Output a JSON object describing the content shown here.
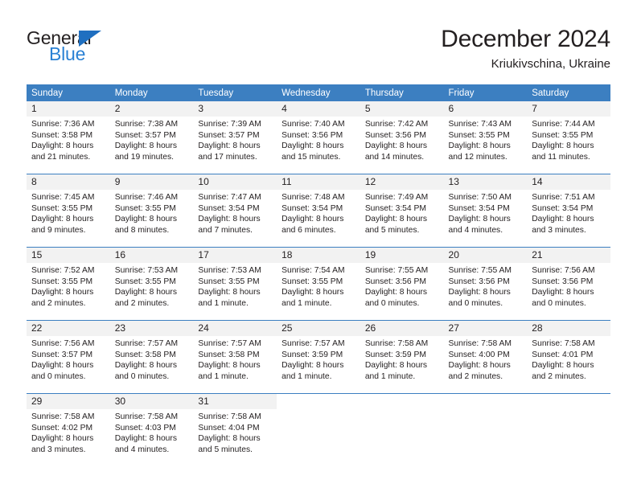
{
  "brand": {
    "name_top": "General",
    "name_bottom": "Blue",
    "color_dark": "#231f20",
    "color_blue": "#2a81d4"
  },
  "header": {
    "title": "December 2024",
    "subtitle": "Kriukivschina, Ukraine"
  },
  "theme": {
    "header_bg": "#3c7fc1",
    "daynum_bg": "#f2f2f2",
    "text": "#231f20"
  },
  "weekdays": [
    "Sunday",
    "Monday",
    "Tuesday",
    "Wednesday",
    "Thursday",
    "Friday",
    "Saturday"
  ],
  "weeks": [
    [
      {
        "day": "1",
        "sunrise": "Sunrise: 7:36 AM",
        "sunset": "Sunset: 3:58 PM",
        "daylight1": "Daylight: 8 hours",
        "daylight2": "and 21 minutes."
      },
      {
        "day": "2",
        "sunrise": "Sunrise: 7:38 AM",
        "sunset": "Sunset: 3:57 PM",
        "daylight1": "Daylight: 8 hours",
        "daylight2": "and 19 minutes."
      },
      {
        "day": "3",
        "sunrise": "Sunrise: 7:39 AM",
        "sunset": "Sunset: 3:57 PM",
        "daylight1": "Daylight: 8 hours",
        "daylight2": "and 17 minutes."
      },
      {
        "day": "4",
        "sunrise": "Sunrise: 7:40 AM",
        "sunset": "Sunset: 3:56 PM",
        "daylight1": "Daylight: 8 hours",
        "daylight2": "and 15 minutes."
      },
      {
        "day": "5",
        "sunrise": "Sunrise: 7:42 AM",
        "sunset": "Sunset: 3:56 PM",
        "daylight1": "Daylight: 8 hours",
        "daylight2": "and 14 minutes."
      },
      {
        "day": "6",
        "sunrise": "Sunrise: 7:43 AM",
        "sunset": "Sunset: 3:55 PM",
        "daylight1": "Daylight: 8 hours",
        "daylight2": "and 12 minutes."
      },
      {
        "day": "7",
        "sunrise": "Sunrise: 7:44 AM",
        "sunset": "Sunset: 3:55 PM",
        "daylight1": "Daylight: 8 hours",
        "daylight2": "and 11 minutes."
      }
    ],
    [
      {
        "day": "8",
        "sunrise": "Sunrise: 7:45 AM",
        "sunset": "Sunset: 3:55 PM",
        "daylight1": "Daylight: 8 hours",
        "daylight2": "and 9 minutes."
      },
      {
        "day": "9",
        "sunrise": "Sunrise: 7:46 AM",
        "sunset": "Sunset: 3:55 PM",
        "daylight1": "Daylight: 8 hours",
        "daylight2": "and 8 minutes."
      },
      {
        "day": "10",
        "sunrise": "Sunrise: 7:47 AM",
        "sunset": "Sunset: 3:54 PM",
        "daylight1": "Daylight: 8 hours",
        "daylight2": "and 7 minutes."
      },
      {
        "day": "11",
        "sunrise": "Sunrise: 7:48 AM",
        "sunset": "Sunset: 3:54 PM",
        "daylight1": "Daylight: 8 hours",
        "daylight2": "and 6 minutes."
      },
      {
        "day": "12",
        "sunrise": "Sunrise: 7:49 AM",
        "sunset": "Sunset: 3:54 PM",
        "daylight1": "Daylight: 8 hours",
        "daylight2": "and 5 minutes."
      },
      {
        "day": "13",
        "sunrise": "Sunrise: 7:50 AM",
        "sunset": "Sunset: 3:54 PM",
        "daylight1": "Daylight: 8 hours",
        "daylight2": "and 4 minutes."
      },
      {
        "day": "14",
        "sunrise": "Sunrise: 7:51 AM",
        "sunset": "Sunset: 3:54 PM",
        "daylight1": "Daylight: 8 hours",
        "daylight2": "and 3 minutes."
      }
    ],
    [
      {
        "day": "15",
        "sunrise": "Sunrise: 7:52 AM",
        "sunset": "Sunset: 3:55 PM",
        "daylight1": "Daylight: 8 hours",
        "daylight2": "and 2 minutes."
      },
      {
        "day": "16",
        "sunrise": "Sunrise: 7:53 AM",
        "sunset": "Sunset: 3:55 PM",
        "daylight1": "Daylight: 8 hours",
        "daylight2": "and 2 minutes."
      },
      {
        "day": "17",
        "sunrise": "Sunrise: 7:53 AM",
        "sunset": "Sunset: 3:55 PM",
        "daylight1": "Daylight: 8 hours",
        "daylight2": "and 1 minute."
      },
      {
        "day": "18",
        "sunrise": "Sunrise: 7:54 AM",
        "sunset": "Sunset: 3:55 PM",
        "daylight1": "Daylight: 8 hours",
        "daylight2": "and 1 minute."
      },
      {
        "day": "19",
        "sunrise": "Sunrise: 7:55 AM",
        "sunset": "Sunset: 3:56 PM",
        "daylight1": "Daylight: 8 hours",
        "daylight2": "and 0 minutes."
      },
      {
        "day": "20",
        "sunrise": "Sunrise: 7:55 AM",
        "sunset": "Sunset: 3:56 PM",
        "daylight1": "Daylight: 8 hours",
        "daylight2": "and 0 minutes."
      },
      {
        "day": "21",
        "sunrise": "Sunrise: 7:56 AM",
        "sunset": "Sunset: 3:56 PM",
        "daylight1": "Daylight: 8 hours",
        "daylight2": "and 0 minutes."
      }
    ],
    [
      {
        "day": "22",
        "sunrise": "Sunrise: 7:56 AM",
        "sunset": "Sunset: 3:57 PM",
        "daylight1": "Daylight: 8 hours",
        "daylight2": "and 0 minutes."
      },
      {
        "day": "23",
        "sunrise": "Sunrise: 7:57 AM",
        "sunset": "Sunset: 3:58 PM",
        "daylight1": "Daylight: 8 hours",
        "daylight2": "and 0 minutes."
      },
      {
        "day": "24",
        "sunrise": "Sunrise: 7:57 AM",
        "sunset": "Sunset: 3:58 PM",
        "daylight1": "Daylight: 8 hours",
        "daylight2": "and 1 minute."
      },
      {
        "day": "25",
        "sunrise": "Sunrise: 7:57 AM",
        "sunset": "Sunset: 3:59 PM",
        "daylight1": "Daylight: 8 hours",
        "daylight2": "and 1 minute."
      },
      {
        "day": "26",
        "sunrise": "Sunrise: 7:58 AM",
        "sunset": "Sunset: 3:59 PM",
        "daylight1": "Daylight: 8 hours",
        "daylight2": "and 1 minute."
      },
      {
        "day": "27",
        "sunrise": "Sunrise: 7:58 AM",
        "sunset": "Sunset: 4:00 PM",
        "daylight1": "Daylight: 8 hours",
        "daylight2": "and 2 minutes."
      },
      {
        "day": "28",
        "sunrise": "Sunrise: 7:58 AM",
        "sunset": "Sunset: 4:01 PM",
        "daylight1": "Daylight: 8 hours",
        "daylight2": "and 2 minutes."
      }
    ],
    [
      {
        "day": "29",
        "sunrise": "Sunrise: 7:58 AM",
        "sunset": "Sunset: 4:02 PM",
        "daylight1": "Daylight: 8 hours",
        "daylight2": "and 3 minutes."
      },
      {
        "day": "30",
        "sunrise": "Sunrise: 7:58 AM",
        "sunset": "Sunset: 4:03 PM",
        "daylight1": "Daylight: 8 hours",
        "daylight2": "and 4 minutes."
      },
      {
        "day": "31",
        "sunrise": "Sunrise: 7:58 AM",
        "sunset": "Sunset: 4:04 PM",
        "daylight1": "Daylight: 8 hours",
        "daylight2": "and 5 minutes."
      },
      {
        "day": "",
        "sunrise": "",
        "sunset": "",
        "daylight1": "",
        "daylight2": ""
      },
      {
        "day": "",
        "sunrise": "",
        "sunset": "",
        "daylight1": "",
        "daylight2": ""
      },
      {
        "day": "",
        "sunrise": "",
        "sunset": "",
        "daylight1": "",
        "daylight2": ""
      },
      {
        "day": "",
        "sunrise": "",
        "sunset": "",
        "daylight1": "",
        "daylight2": ""
      }
    ]
  ]
}
